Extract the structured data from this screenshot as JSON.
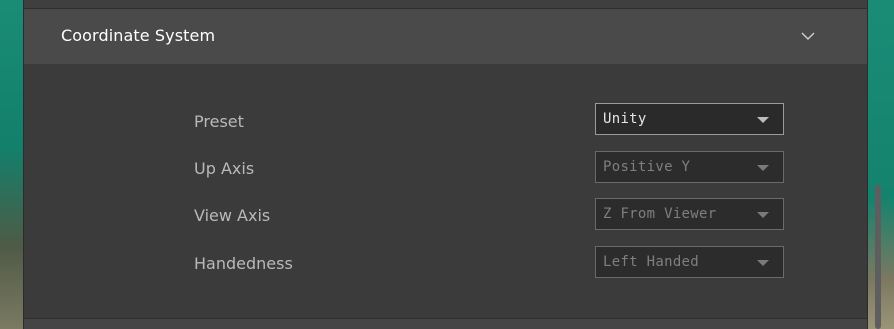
{
  "section": {
    "title": "Coordinate System",
    "expanded_icon": "chevron-up-icon"
  },
  "rows": [
    {
      "label": "Preset",
      "value": "Unity",
      "enabled": true
    },
    {
      "label": "Up Axis",
      "value": "Positive Y",
      "enabled": false
    },
    {
      "label": "View Axis",
      "value": "Z From Viewer",
      "enabled": false
    },
    {
      "label": "Handedness",
      "value": "Left Handed",
      "enabled": false
    }
  ],
  "colors": {
    "panel_bg": "#3b3b3b",
    "header_bg": "#4a4a4a",
    "label_text": "#b9b9b9",
    "disabled_text": "#7f7f7f",
    "enabled_text": "#e6e6e6",
    "backdrop": "#1a8c76"
  }
}
